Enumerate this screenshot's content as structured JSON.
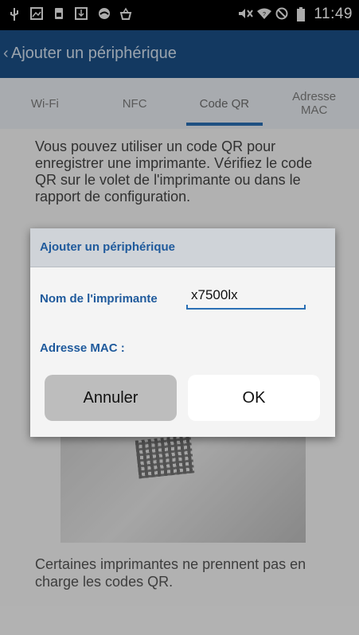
{
  "status_bar": {
    "icons": [
      "usb-icon",
      "image-icon",
      "sim-icon",
      "download-icon",
      "cloud-icon",
      "shopping-icon",
      "mute-icon",
      "wifi-icon",
      "block-icon",
      "battery-icon"
    ],
    "time": "11:49"
  },
  "app_bar": {
    "back_glyph": "‹",
    "title": "Ajouter un périphérique"
  },
  "tabs": [
    {
      "label": "Wi-Fi",
      "active": false
    },
    {
      "label": "NFC",
      "active": false
    },
    {
      "label": "Code QR",
      "active": true
    },
    {
      "label": "Adresse\nMAC",
      "active": false
    }
  ],
  "content": {
    "intro": "Vous pouvez utiliser un code QR pour enregistrer une imprimante. Vérifiez le code QR sur le volet de l'imprimante ou dans le rapport de configuration.",
    "note": "Certaines imprimantes ne prennent pas en charge les codes QR."
  },
  "dialog": {
    "title": "Ajouter un périphérique",
    "name_label": "Nom de l'imprimante",
    "name_value": "x7500lx",
    "mac_label": "Adresse MAC :",
    "cancel_label": "Annuler",
    "ok_label": "OK"
  },
  "colors": {
    "app_bar": "#1b4f87",
    "accent": "#2a6fb5",
    "dialog_label": "#1f5a9c"
  }
}
